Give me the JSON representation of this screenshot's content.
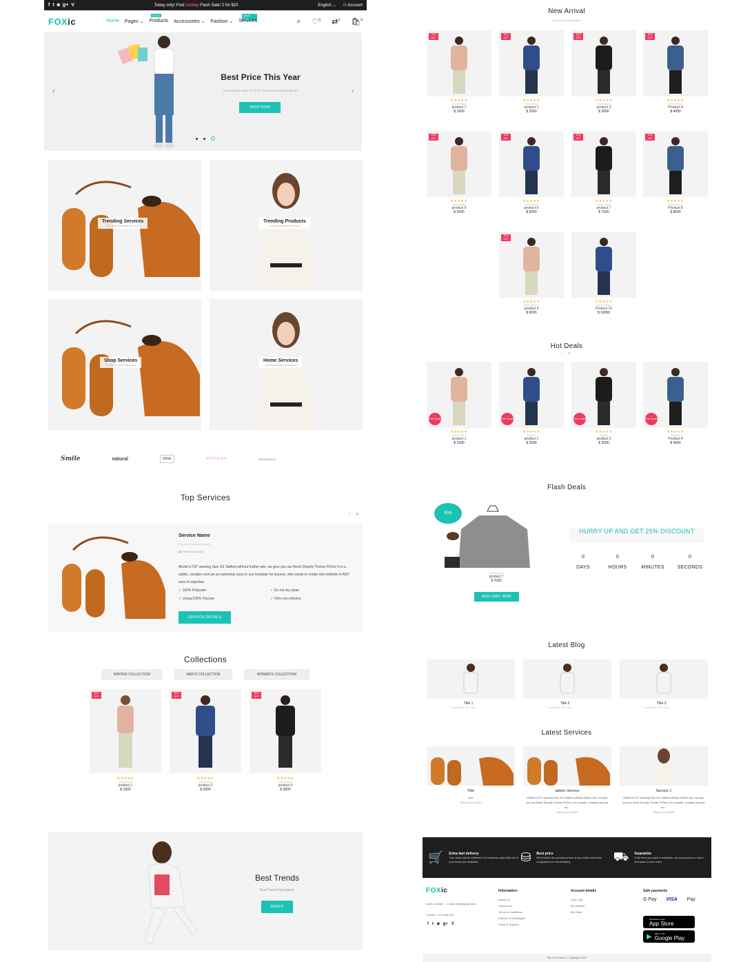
{
  "topbar": {
    "promo_pre": "Today only! Post",
    "promo_hl": "holiday",
    "promo_post": "Flash Sale! 2 for $20",
    "language": "English",
    "account": "Account"
  },
  "nav": {
    "logo_a": "FOX",
    "logo_b": "ic",
    "items": [
      {
        "label": "Home",
        "tag": ""
      },
      {
        "label": "Pages",
        "tag": ""
      },
      {
        "label": "Products",
        "tag": "SALE"
      },
      {
        "label": "Accessories",
        "tag": ""
      },
      {
        "label": "Fashion",
        "tag": ""
      },
      {
        "label": "Services",
        "tag": "Book Now"
      }
    ],
    "wishlist_count": "0",
    "compare_count": "0",
    "cart_count": "0"
  },
  "hero": {
    "title": "Best Price This Year",
    "subtitle": "Lorem ipsum dolor sit amet, consectetur adipiscing elit.",
    "button": "SHOP NOW"
  },
  "cards": [
    {
      "title": "Trending Services",
      "sub": "The Best Trending Services"
    },
    {
      "title": "Trending Products",
      "sub": "Live according to Fashion"
    },
    {
      "title": "Shop Services",
      "sub": "The Best Look Anywhere"
    },
    {
      "title": "Home Services",
      "sub": "Live according to Fashion"
    }
  ],
  "brands": [
    "Smile",
    "natural",
    "White",
    "AFFRESH",
    "ORGANIC"
  ],
  "top_services": {
    "title": "Top Services",
    "service_name": "Service Name",
    "provider": "Provider: Business Name",
    "start": "Start From:$1000",
    "desc": "Model is 5'9\" wearing Size XS TallAnd without further ado, we give you our finest Shopify Theme FOXic! It is a subtle, complex and yet an extremely easy to use template for anyone, who wants to create own website in ANY area of expertise.",
    "f1": "100% Polyester",
    "f2": "Do not dry clean",
    "f3": "Lining:100% Viscose",
    "f4": "Only non-chlorine",
    "button": "SERVICE DETAILS"
  },
  "collections": {
    "title": "Collections",
    "tabs": [
      "WINTER COLLECTION",
      "MEN'S COLLECTION",
      "WOMEN'S COLLECTION"
    ],
    "products": [
      {
        "badge": "10% OFF",
        "brand": "Admin Brand",
        "name": "product 1",
        "price": "$ 1000"
      },
      {
        "badge": "10% OFF",
        "brand": "Admin Brand",
        "name": "product 2",
        "price": "$ 2000"
      },
      {
        "badge": "30% OFF",
        "brand": "Admin Brand",
        "name": "product 3",
        "price": "$ 3000"
      }
    ]
  },
  "trends": {
    "title": "Best Trends",
    "sub": "Best Trend Description",
    "button": "SHOPS"
  },
  "new_arrival": {
    "title": "New Arrival",
    "sub": "New Arrival Description",
    "products": [
      {
        "badge": "10% OFF",
        "brand": "Admin Brand",
        "name": "product 1",
        "price": "$ 1000"
      },
      {
        "badge": "10% OFF",
        "brand": "Admin Brand",
        "name": "product 2",
        "price": "$ 2000"
      },
      {
        "badge": "30% OFF",
        "brand": "Admin Brand",
        "name": "product 3",
        "price": "$ 3000"
      },
      {
        "badge": "10% OFF",
        "brand": "Admin Brand",
        "name": "Product 4",
        "price": "$ 4000"
      },
      {
        "badge": "10% OFF",
        "brand": "Admin Brand",
        "name": "product 5",
        "price": "$ 5000"
      },
      {
        "badge": "10% OFF",
        "brand": "Seller Brand",
        "name": "product 6",
        "price": "$ 6000"
      },
      {
        "badge": "10% OFF",
        "brand": "Seller Brand",
        "name": "product 7",
        "price": "$ 7000"
      },
      {
        "badge": "10% OFF",
        "brand": "Seller Brand",
        "name": "Product 8",
        "price": "$ 8000"
      },
      {
        "badge": "10% OFF",
        "brand": "Seller Brand 2",
        "name": "product 9",
        "price": "$ 9000"
      },
      {
        "badge": "",
        "brand": "Admin Brand 1",
        "name": "Product 10",
        "price": "$ 10000"
      }
    ]
  },
  "hot_deals": {
    "title": "Hot Deals",
    "badge": "Hot Deals",
    "products": [
      {
        "brand": "Accessories",
        "name": "product 1",
        "price": "$ 1000"
      },
      {
        "brand": "Fashion",
        "name": "product 2",
        "price": "$ 2000"
      },
      {
        "brand": "Fashion",
        "name": "product 3",
        "price": "$ 3000"
      },
      {
        "brand": "Fashion",
        "name": "Product 4",
        "price": "$ 4000"
      }
    ]
  },
  "flash": {
    "title": "Flash Deals",
    "badge": "50%",
    "brand": "Seller Brand",
    "name": "product 7",
    "price": "$ 7000",
    "button": "ADD CART NOW",
    "headline": "HURRY UP AND GET 25% DISCOUNT",
    "count": [
      {
        "n": "0",
        "l": "DAYS"
      },
      {
        "n": "0",
        "l": "HOURS"
      },
      {
        "n": "0",
        "l": "MINUTES"
      },
      {
        "n": "0",
        "l": "SECONDS"
      }
    ]
  },
  "blog": {
    "title": "Latest Blog",
    "posts": [
      {
        "title": "Title 1",
        "date": "December 03, 2021"
      },
      {
        "title": "Title 2",
        "date": "December 04, 2021"
      },
      {
        "title": "Title 3",
        "date": "December 04, 2021"
      }
    ]
  },
  "services": {
    "title": "Latest Services",
    "items": [
      {
        "title": "Title",
        "desc": "text",
        "start": "Start From $1000"
      },
      {
        "title": "admin Service",
        "desc": "Model is 5'9\" wearing Size XS TallAnd without further ado, we give you our finest Shopify Theme FOXic! It is a subtle, complex and yet an...",
        "start": "Start From $3000"
      },
      {
        "title": "Service 1",
        "desc": "Model is 5'9\" wearing Size XS TallAnd without further ado, we give you our finest Shopify Theme FOXic! It is a subtle, complex and yet an...",
        "start": "Start From $2000"
      }
    ]
  },
  "features": [
    {
      "title": "Extra fast delivery",
      "text": "Your order will be delivered 3-5 business days after all of your items are available"
    },
    {
      "title": "Best price",
      "text": "We'll match the product prices of key online and local competitors for immediately"
    },
    {
      "title": "Guarantee",
      "text": "If the item you want is available, we can process a return and place a new order"
    }
  ],
  "footer": {
    "about": "footer_section_...e-mail: site@gmail.com",
    "contact": "Contact: +123 456 789",
    "info_h": "Information",
    "info": [
      "About Us",
      "Contact Us",
      "Terms & Conditions",
      "Returns & Exchanges",
      "Policy & Support"
    ],
    "acc_h": "Account details",
    "acc": [
      "View Cart",
      "My Wishlist",
      "My Order"
    ],
    "pay_h": "Safe payments",
    "pay": [
      "G Pay",
      "VISA",
      "Pay"
    ],
    "appstore_small": "Download on the",
    "appstore": "App Store",
    "gplay_small": "GET IT ON",
    "gplay": "Google Play",
    "copyright": "Site Full Name © Copyright 2021"
  }
}
